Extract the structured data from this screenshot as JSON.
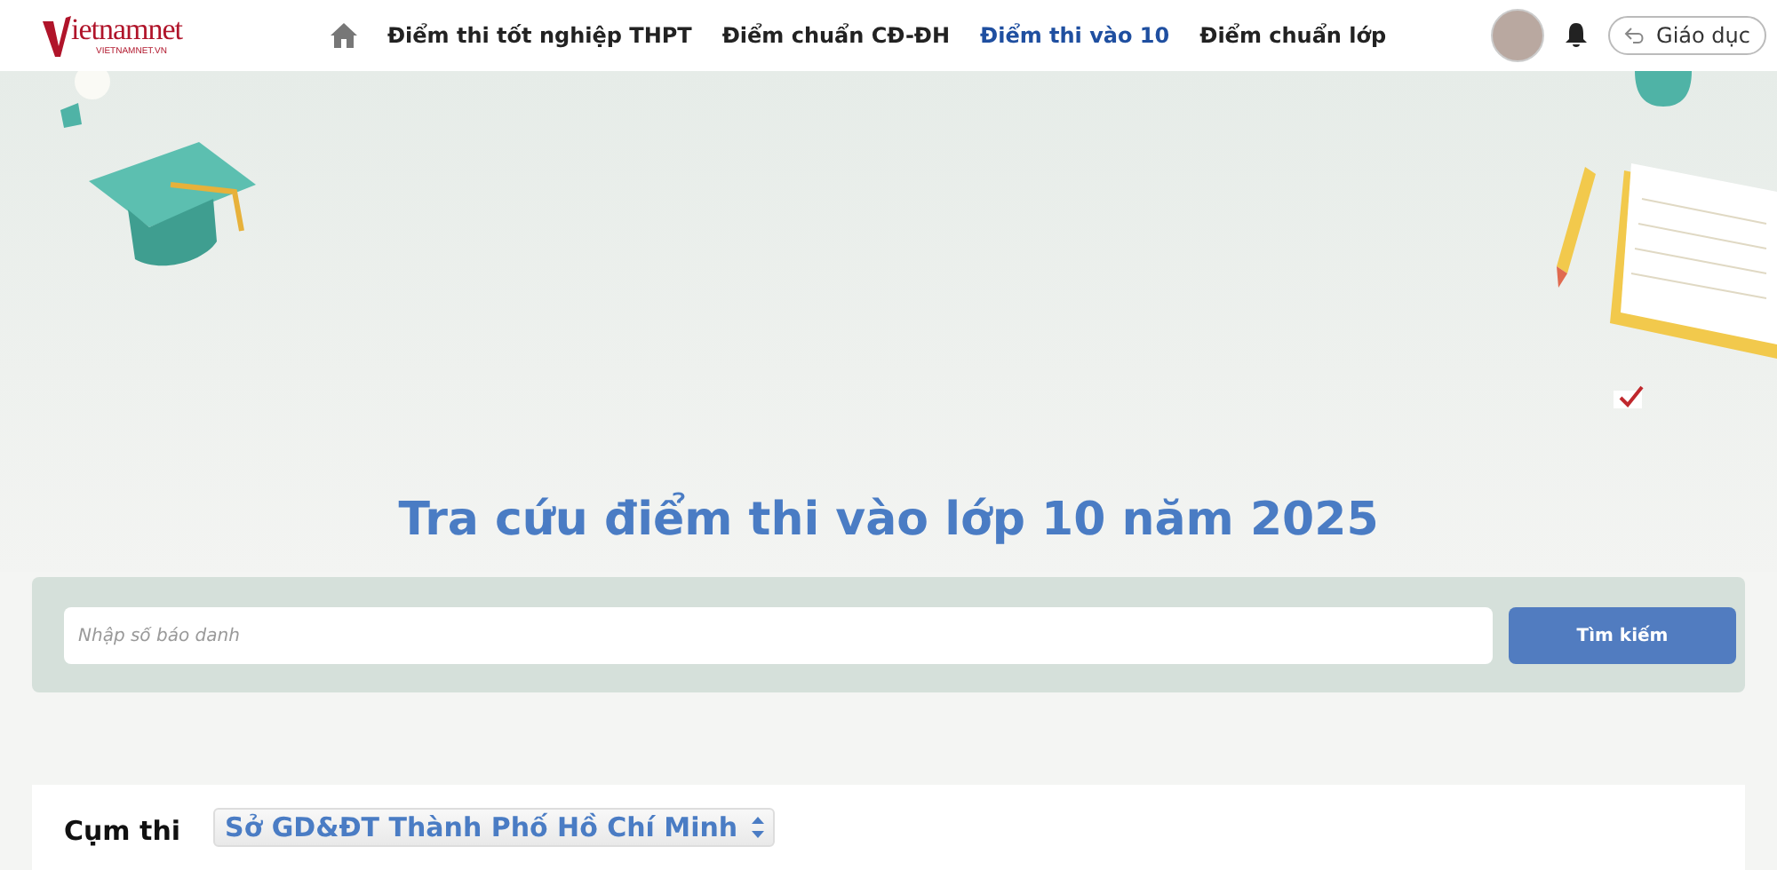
{
  "header": {
    "logo": {
      "text": "ietnamnet",
      "subtext": "VIETNAMNET.VN"
    },
    "nav": [
      {
        "label": "Điểm thi tốt nghiệp THPT",
        "selected": false
      },
      {
        "label": "Điểm chuẩn CĐ-ĐH",
        "selected": false
      },
      {
        "label": "Điểm thi vào 10",
        "selected": true
      },
      {
        "label": "Điểm chuẩn lớp",
        "selected": false
      }
    ],
    "section_button": "Giáo dục"
  },
  "hero": {
    "title": "Tra cứu điểm thi vào lớp 10 năm 2025"
  },
  "search": {
    "placeholder": "Nhập số báo danh",
    "button": "Tìm kiếm"
  },
  "filter": {
    "label": "Cụm thi",
    "value": "Sở GD&ĐT Thành Phố Hồ Chí Minh"
  }
}
